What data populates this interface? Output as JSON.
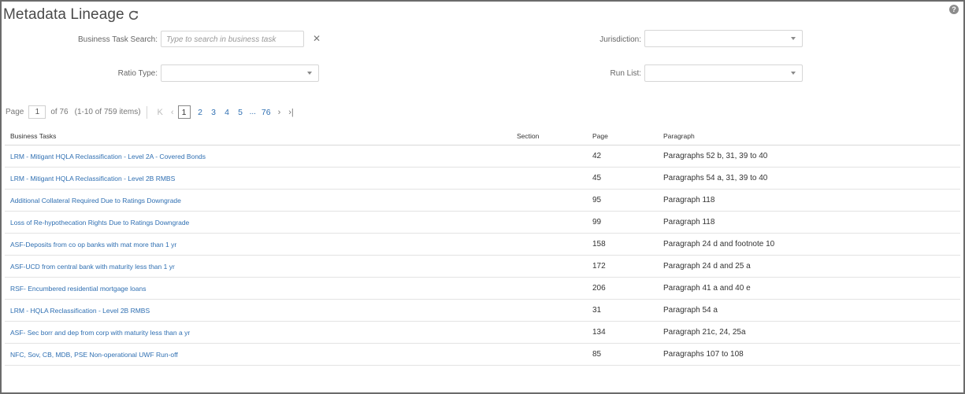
{
  "header": {
    "title": "Metadata Lineage",
    "help_label": "?"
  },
  "filters": {
    "business_task_search_label": "Business Task Search:",
    "business_task_search_placeholder": "Type to search in business task",
    "business_task_search_value": "",
    "ratio_type_label": "Ratio Type:",
    "ratio_type_value": "",
    "jurisdiction_label": "Jurisdiction:",
    "jurisdiction_value": "",
    "run_list_label": "Run List:",
    "run_list_value": ""
  },
  "pager": {
    "page_label": "Page",
    "current_page": "1",
    "of_total": "of 76",
    "items_info": "(1-10 of 759 items)",
    "pages": [
      "1",
      "2",
      "3",
      "4",
      "5"
    ],
    "ellipsis": "...",
    "last_page": "76"
  },
  "table": {
    "columns": [
      "Business Tasks",
      "Section",
      "Page",
      "Paragraph"
    ],
    "rows": [
      {
        "task": "LRM - Mitigant HQLA Reclassification - Level 2A - Covered Bonds",
        "section": "",
        "page": "42",
        "paragraph": "Paragraphs 52 b, 31, 39 to 40"
      },
      {
        "task": "LRM - Mitigant HQLA Reclassification - Level 2B RMBS",
        "section": "",
        "page": "45",
        "paragraph": "Paragraphs 54 a, 31, 39 to 40"
      },
      {
        "task": "Additional Collateral Required Due to Ratings Downgrade",
        "section": "",
        "page": "95",
        "paragraph": "Paragraph 118"
      },
      {
        "task": "Loss of Re-hypothecation Rights Due to Ratings Downgrade",
        "section": "",
        "page": "99",
        "paragraph": "Paragraph 118"
      },
      {
        "task": "ASF-Deposits from co op banks with mat more than 1 yr",
        "section": "",
        "page": "158",
        "paragraph": "Paragraph 24 d and footnote 10"
      },
      {
        "task": "ASF-UCD from central bank with maturity less than 1 yr",
        "section": "",
        "page": "172",
        "paragraph": "Paragraph 24 d and 25 a"
      },
      {
        "task": "RSF- Encumbered residential mortgage loans",
        "section": "",
        "page": "206",
        "paragraph": "Paragraph 41 a and 40 e"
      },
      {
        "task": "LRM - HQLA Reclassification - Level 2B RMBS",
        "section": "",
        "page": "31",
        "paragraph": "Paragraph 54 a"
      },
      {
        "task": "ASF- Sec borr and dep from corp with maturity less than a yr",
        "section": "",
        "page": "134",
        "paragraph": "Paragraph 21c, 24, 25a"
      },
      {
        "task": "NFC, Sov, CB, MDB, PSE Non-operational UWF Run-off",
        "section": "",
        "page": "85",
        "paragraph": "Paragraphs 107 to 108"
      }
    ]
  },
  "colors": {
    "link": "#2f6fb2",
    "border": "#6b6b6b",
    "text": "#333333"
  },
  "icons": [
    "refresh-icon",
    "help-icon",
    "clear-icon",
    "chevron-down-icon",
    "first-page-icon",
    "prev-page-icon",
    "next-page-icon",
    "last-page-icon"
  ]
}
